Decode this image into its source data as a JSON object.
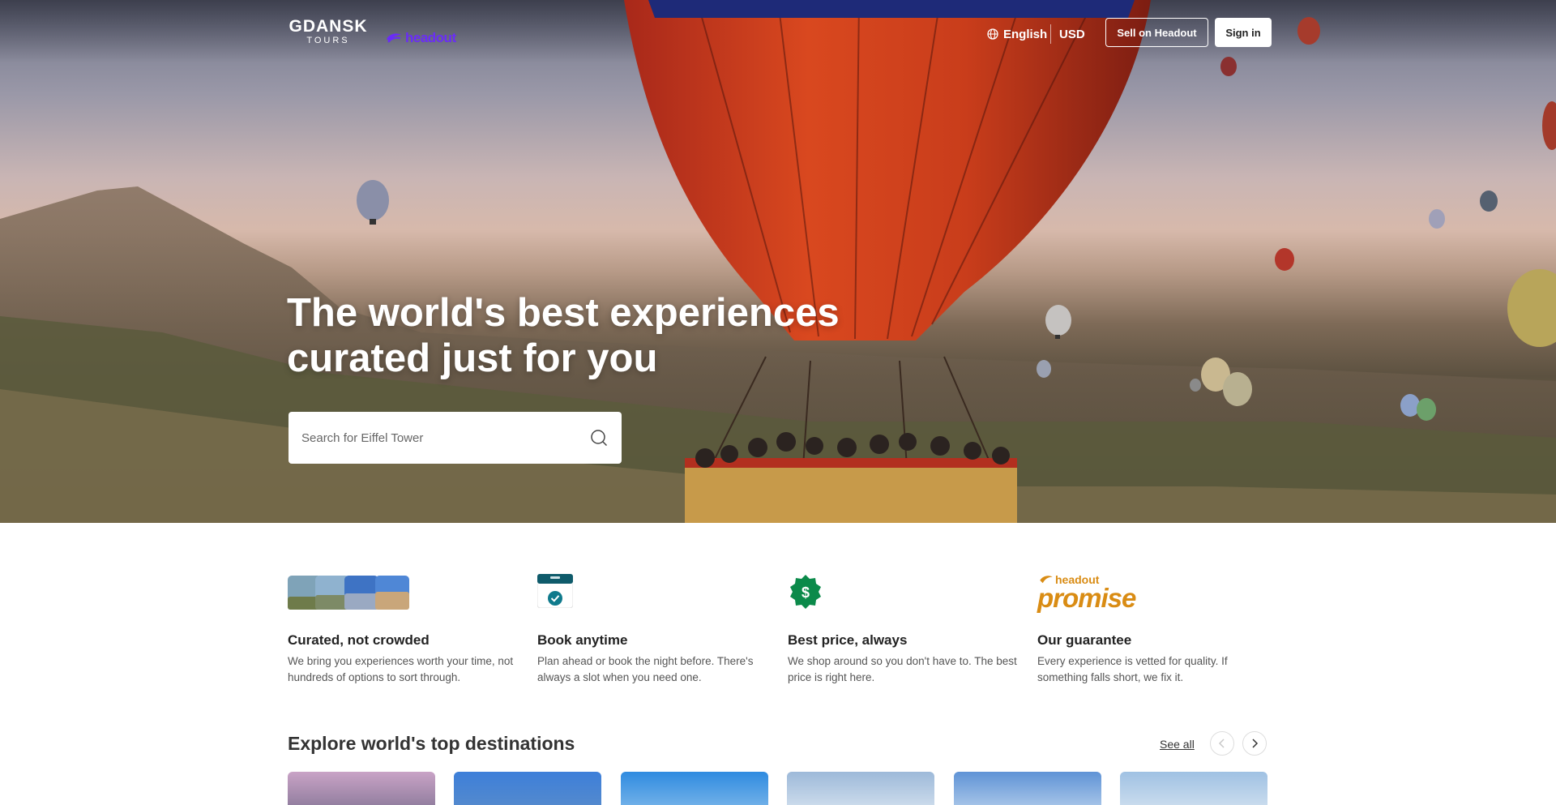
{
  "header": {
    "brand_line1": "GDANSK",
    "brand_line2": "TOURS",
    "partner_name": "headout",
    "language": "English",
    "currency": "USD",
    "sell_button": "Sell on Headout",
    "signin_button": "Sign in"
  },
  "hero": {
    "heading_line1": "The world's best experiences",
    "heading_line2": "curated just for you",
    "search_placeholder": "Search for Eiffel Tower"
  },
  "value_props": [
    {
      "title": "Curated, not crowded",
      "text": "We bring you experiences worth your time, not hundreds of options to sort through.",
      "icon": "photo-stack-icon"
    },
    {
      "title": "Book anytime",
      "text": "Plan ahead or book the night before. There's always a slot when you need one.",
      "icon": "calendar-check-icon"
    },
    {
      "title": "Best price, always",
      "text": "We shop around so you don't have to. The best price is right here.",
      "icon": "dollar-badge-icon"
    },
    {
      "title": "Our guarantee",
      "text": "Every experience is vetted for quality. If something falls short, we fix it.",
      "icon": "headout-promise-logo",
      "logo_small": "headout",
      "logo_big": "promise"
    }
  ],
  "destinations": {
    "title": "Explore world's top destinations",
    "see_all": "See all",
    "cards": [
      {
        "name": "",
        "color_top": "#c9a3c6",
        "color_bottom": "#7b6f8f"
      },
      {
        "name": "",
        "color_top": "#3d7fd9",
        "color_bottom": "#5d8ec9"
      },
      {
        "name": "",
        "color_top": "#2f8be0",
        "color_bottom": "#8cc0ec"
      },
      {
        "name": "",
        "color_top": "#9db9d9",
        "color_bottom": "#dfe9f3"
      },
      {
        "name": "",
        "color_top": "#5f93d6",
        "color_bottom": "#c3d8ef"
      },
      {
        "name": "",
        "color_top": "#9fc1e3",
        "color_bottom": "#dbe7f2"
      }
    ]
  },
  "colors": {
    "brand_purple": "#6a2cf7",
    "promise_gold": "#d98c14",
    "check_teal": "#0f7a8c",
    "dollar_green": "#0b8a4a"
  }
}
